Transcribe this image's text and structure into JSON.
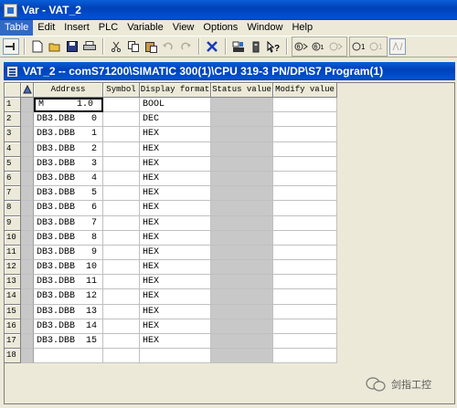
{
  "app": {
    "title": "Var - VAT_2"
  },
  "menu": [
    "Table",
    "Edit",
    "Insert",
    "PLC",
    "Variable",
    "View",
    "Options",
    "Window",
    "Help"
  ],
  "toolbar": {
    "icons": [
      "pin-icon",
      "new-icon",
      "open-icon",
      "save-icon",
      "print-icon",
      "cut-icon",
      "copy-icon",
      "paste-icon",
      "undo-icon",
      "redo-icon",
      "delete-icon",
      "online-icon",
      "monitor-icon",
      "help-icon",
      "monitor-variable-icon",
      "modify-variable-icon",
      "modify-disabled-icon",
      "trigger-icon",
      "trigger-disabled-icon",
      "force-disabled-icon"
    ]
  },
  "window": {
    "title": "VAT_2 -- comS71200\\SIMATIC 300(1)\\CPU 319-3 PN/DP\\S7 Program(1)"
  },
  "table": {
    "columns": [
      "Address",
      "Symbol",
      "Display format",
      "Status value",
      "Modify value"
    ],
    "rows": [
      {
        "n": "1",
        "address": "M      1.0",
        "symbol": "",
        "format": "BOOL"
      },
      {
        "n": "2",
        "address": "DB3.DBB   0",
        "symbol": "",
        "format": "DEC"
      },
      {
        "n": "3",
        "address": "DB3.DBB   1",
        "symbol": "",
        "format": "HEX"
      },
      {
        "n": "4",
        "address": "DB3.DBB   2",
        "symbol": "",
        "format": "HEX"
      },
      {
        "n": "5",
        "address": "DB3.DBB   3",
        "symbol": "",
        "format": "HEX"
      },
      {
        "n": "6",
        "address": "DB3.DBB   4",
        "symbol": "",
        "format": "HEX"
      },
      {
        "n": "7",
        "address": "DB3.DBB   5",
        "symbol": "",
        "format": "HEX"
      },
      {
        "n": "8",
        "address": "DB3.DBB   6",
        "symbol": "",
        "format": "HEX"
      },
      {
        "n": "9",
        "address": "DB3.DBB   7",
        "symbol": "",
        "format": "HEX"
      },
      {
        "n": "10",
        "address": "DB3.DBB   8",
        "symbol": "",
        "format": "HEX"
      },
      {
        "n": "11",
        "address": "DB3.DBB   9",
        "symbol": "",
        "format": "HEX"
      },
      {
        "n": "12",
        "address": "DB3.DBB  10",
        "symbol": "",
        "format": "HEX"
      },
      {
        "n": "13",
        "address": "DB3.DBB  11",
        "symbol": "",
        "format": "HEX"
      },
      {
        "n": "14",
        "address": "DB3.DBB  12",
        "symbol": "",
        "format": "HEX"
      },
      {
        "n": "15",
        "address": "DB3.DBB  13",
        "symbol": "",
        "format": "HEX"
      },
      {
        "n": "16",
        "address": "DB3.DBB  14",
        "symbol": "",
        "format": "HEX"
      },
      {
        "n": "17",
        "address": "DB3.DBB  15",
        "symbol": "",
        "format": "HEX"
      },
      {
        "n": "18",
        "address": "",
        "symbol": "",
        "format": ""
      }
    ]
  },
  "watermark": {
    "text": "剑指工控"
  },
  "colors": {
    "titlebar": "#0041b8",
    "menu_highlight": "#316ac5",
    "status_column": "#c8c8c8"
  }
}
